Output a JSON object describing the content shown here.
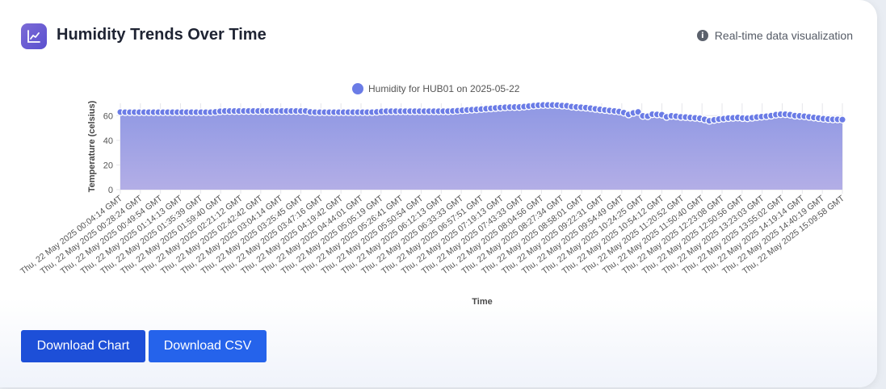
{
  "header": {
    "title": "Humidity Trends Over Time",
    "subtitle": "Real-time data visualization",
    "icon": "line-chart-icon",
    "info_icon": "info-icon"
  },
  "buttons": {
    "download_chart": "Download Chart",
    "download_csv": "Download CSV"
  },
  "colors": {
    "accent": "#6b7ce6",
    "fill_top": "#8f98e4",
    "fill_bottom": "#b3aee6",
    "button_primary": "#1d4fd8"
  },
  "chart_data": {
    "type": "area",
    "legend": {
      "label": "Humidity for HUB01 on 2025-05-22",
      "position": "top"
    },
    "xlabel": "Time",
    "ylabel": "Temperature (celsius)",
    "ylim": [
      0,
      70
    ],
    "yticks": [
      0,
      20,
      40,
      60
    ],
    "grid": true,
    "tick_labels": [
      "Thu, 22 May 2025 00:04:14 GMT",
      "Thu, 22 May 2025 00:28:24 GMT",
      "Thu, 22 May 2025 00:49:54 GMT",
      "Thu, 22 May 2025 01:14:13 GMT",
      "Thu, 22 May 2025 01:35:39 GMT",
      "Thu, 22 May 2025 01:59:40 GMT",
      "Thu, 22 May 2025 02:21:12 GMT",
      "Thu, 22 May 2025 02:42:42 GMT",
      "Thu, 22 May 2025 03:04:14 GMT",
      "Thu, 22 May 2025 03:25:45 GMT",
      "Thu, 22 May 2025 03:47:16 GMT",
      "Thu, 22 May 2025 04:19:42 GMT",
      "Thu, 22 May 2025 04:44:01 GMT",
      "Thu, 22 May 2025 05:05:19 GMT",
      "Thu, 22 May 2025 05:26:41 GMT",
      "Thu, 22 May 2025 05:50:54 GMT",
      "Thu, 22 May 2025 06:12:13 GMT",
      "Thu, 22 May 2025 06:33:33 GMT",
      "Thu, 22 May 2025 06:57:51 GMT",
      "Thu, 22 May 2025 07:19:13 GMT",
      "Thu, 22 May 2025 07:43:33 GMT",
      "Thu, 22 May 2025 08:04:56 GMT",
      "Thu, 22 May 2025 08:27:34 GMT",
      "Thu, 22 May 2025 08:58:01 GMT",
      "Thu, 22 May 2025 09:22:31 GMT",
      "Thu, 22 May 2025 09:54:49 GMT",
      "Thu, 22 May 2025 10:24:25 GMT",
      "Thu, 22 May 2025 10:54:12 GMT",
      "Thu, 22 May 2025 11:20:52 GMT",
      "Thu, 22 May 2025 11:50:40 GMT",
      "Thu, 22 May 2025 12:23:08 GMT",
      "Thu, 22 May 2025 12:50:56 GMT",
      "Thu, 22 May 2025 13:23:03 GMT",
      "Thu, 22 May 2025 13:55:02 GMT",
      "Thu, 22 May 2025 14:19:14 GMT",
      "Thu, 22 May 2025 14:40:19 GMT",
      "Thu, 22 May 2025 15:09:58 GMT"
    ],
    "values": [
      62.9,
      62.8,
      62.8,
      62.8,
      62.8,
      62.8,
      62.8,
      62.8,
      62.8,
      62.8,
      62.8,
      62.8,
      62.8,
      62.8,
      62.8,
      62.8,
      62.8,
      62.8,
      62.8,
      62.8,
      63.0,
      63.5,
      63.7,
      63.7,
      63.7,
      63.7,
      63.8,
      63.8,
      63.8,
      63.8,
      63.8,
      63.8,
      63.8,
      63.8,
      63.8,
      63.8,
      63.8,
      63.8,
      63.8,
      63.8,
      63.0,
      62.8,
      62.8,
      62.8,
      62.8,
      62.8,
      62.8,
      62.8,
      62.8,
      62.8,
      62.8,
      62.8,
      62.8,
      62.8,
      63.0,
      63.4,
      63.6,
      63.6,
      63.6,
      63.6,
      63.6,
      63.6,
      63.6,
      63.6,
      63.6,
      63.6,
      63.6,
      63.6,
      63.6,
      63.6,
      63.8,
      64.0,
      64.3,
      64.6,
      64.8,
      65.0,
      65.3,
      65.6,
      65.9,
      66.2,
      66.5,
      66.8,
      66.9,
      67.0,
      67.0,
      67.3,
      67.7,
      68.1,
      68.4,
      68.6,
      68.6,
      68.6,
      68.5,
      68.2,
      68.0,
      67.3,
      67.0,
      66.8,
      66.5,
      66.0,
      65.5,
      65.0,
      64.6,
      64.2,
      63.8,
      63.3,
      62.5,
      61.0,
      62.2,
      63.0,
      59.8,
      59.5,
      61.2,
      61.0,
      60.8,
      59.0,
      59.8,
      59.5,
      59.0,
      58.8,
      58.5,
      58.2,
      57.8,
      57.0,
      55.8,
      56.5,
      57.2,
      57.6,
      58.0,
      58.2,
      58.5,
      58.0,
      57.8,
      58.3,
      58.8,
      59.2,
      59.5,
      60.0,
      60.8,
      61.2,
      61.2,
      60.8,
      60.0,
      59.8,
      59.5,
      59.0,
      58.5,
      58.0,
      57.5,
      57.2,
      57.0,
      57.0,
      56.8
    ]
  }
}
